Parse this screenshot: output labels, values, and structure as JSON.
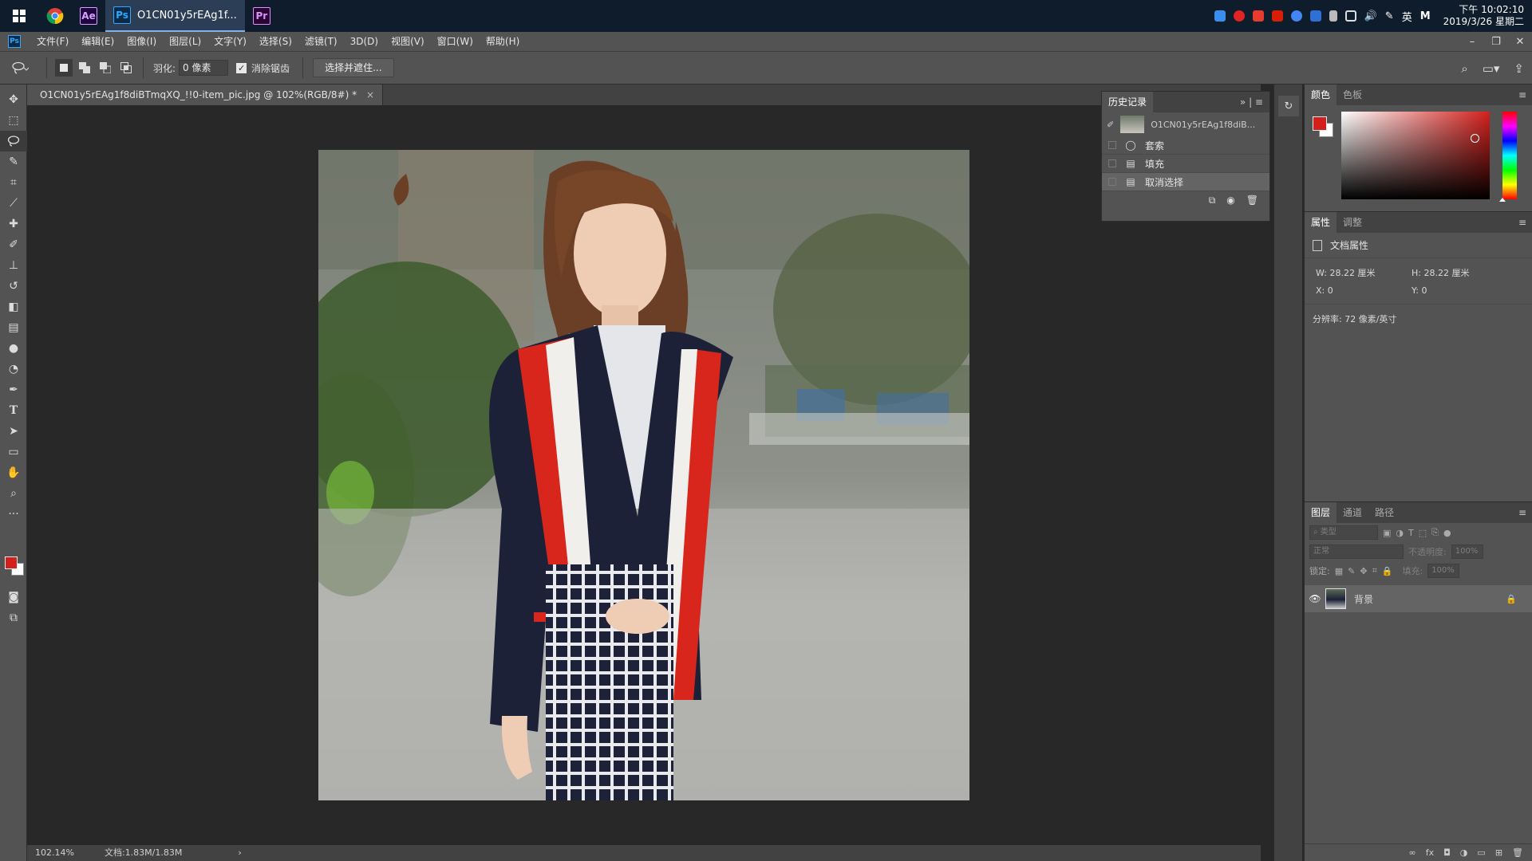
{
  "taskbar": {
    "active_title": "O1CN01y5rEAg1f...",
    "apps": [
      "Ae",
      "Ps",
      "Pr"
    ],
    "ime_label": "英",
    "clock_time": "下午 10:02:10",
    "clock_date": "2019/3/26 星期二"
  },
  "menu": {
    "items": [
      "文件(F)",
      "编辑(E)",
      "图像(I)",
      "图层(L)",
      "文字(Y)",
      "选择(S)",
      "滤镜(T)",
      "3D(D)",
      "视图(V)",
      "窗口(W)",
      "帮助(H)"
    ]
  },
  "options": {
    "feather_label": "羽化:",
    "feather_value": "0 像素",
    "antialias_label": "消除锯齿",
    "select_mask_label": "选择并遮住..."
  },
  "document": {
    "tab_title": "O1CN01y5rEAg1f8diBTmqXQ_!!0-item_pic.jpg @ 102%(RGB/8#) *",
    "tab_close": "×",
    "zoom": "102.14%",
    "doc_size": "文档:1.83M/1.83M",
    "status_arrow": "›"
  },
  "history": {
    "tab": "历史记录",
    "snapshot": "O1CN01y5rEAg1f8diB...",
    "rows": [
      {
        "icon": "lasso-icon",
        "label": "套索"
      },
      {
        "icon": "fill-icon",
        "label": "填充"
      },
      {
        "icon": "deselect-icon",
        "label": "取消选择"
      }
    ]
  },
  "color_panel": {
    "tabs": [
      "颜色",
      "色板"
    ],
    "foreground": "#d3201c",
    "background": "#ffffff"
  },
  "properties_panel": {
    "tabs": [
      "属性",
      "调整"
    ],
    "title": "文档属性",
    "w_label": "W:",
    "w_value": "28.22 厘米",
    "h_label": "H:",
    "h_value": "28.22 厘米",
    "x_label": "X:",
    "x_value": "0",
    "y_label": "Y:",
    "y_value": "0",
    "resolution": "分辨率: 72 像素/英寸"
  },
  "layers_panel": {
    "tabs": [
      "图层",
      "通道",
      "路径"
    ],
    "filter_placeholder": "类型",
    "blend_mode": "正常",
    "opacity_label": "不透明度:",
    "opacity_value": "100%",
    "lock_label": "锁定:",
    "fill_label": "填充:",
    "fill_value": "100%",
    "layer_name": "背景"
  }
}
